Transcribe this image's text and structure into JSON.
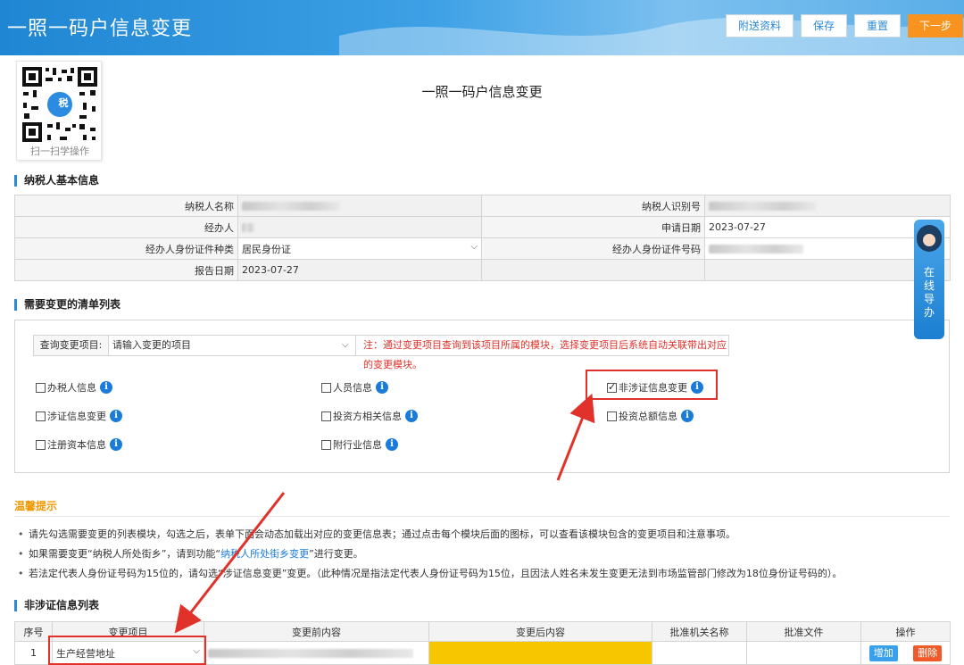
{
  "header": {
    "title": "一照一码户信息变更",
    "buttons": {
      "attach": "附送资料",
      "save": "保存",
      "reset": "重置",
      "next": "下一步"
    }
  },
  "qr": {
    "caption": "扫一扫学操作",
    "logo_text": "税"
  },
  "page_title": "一照一码户信息变更",
  "basic_info": {
    "section_title": "纳税人基本信息",
    "labels": {
      "taxpayer_name": "纳税人名称",
      "taxpayer_id": "纳税人识别号",
      "agent": "经办人",
      "apply_date": "申请日期",
      "id_type": "经办人身份证件种类",
      "id_no": "经办人身份证件号码",
      "report_date": "报告日期"
    },
    "values": {
      "apply_date": "2023-07-27",
      "id_type": "居民身份证",
      "report_date": "2023-07-27"
    }
  },
  "change_list": {
    "section_title": "需要变更的清单列表",
    "query_label": "查询变更项目:",
    "query_placeholder": "请输入变更的项目",
    "query_note": "注：通过变更项目查询到该项目所属的模块，选择变更项目后系统自动关联带出对应的变更模块。",
    "options": [
      {
        "label": "办税人信息",
        "checked": false
      },
      {
        "label": "人员信息",
        "checked": false
      },
      {
        "label": "非涉证信息变更",
        "checked": true
      },
      {
        "label": "涉证信息变更",
        "checked": false
      },
      {
        "label": "投资方相关信息",
        "checked": false
      },
      {
        "label": "投资总额信息",
        "checked": false
      },
      {
        "label": "注册资本信息",
        "checked": false
      },
      {
        "label": "附行业信息",
        "checked": false
      }
    ]
  },
  "tips": {
    "title": "温馨提示",
    "line1": "请先勾选需要变更的列表模块，勾选之后，表单下面会动态加载出对应的变更信息表；通过点击每个模块后面的图标，可以查看该模块包含的变更项目和注意事项。",
    "line2_a": "如果需要变更“纳税人所处街乡”，请到功能“",
    "line2_link": "纳税人所处街乡变更",
    "line2_b": "”进行变更。",
    "line3": "若法定代表人身份证号码为15位的，请勾选“涉证信息变更”变更。（此种情况是指法定代表人身份证号码为15位，且因法人姓名未发生变更无法到市场监管部门修改为18位身份证号码的）。"
  },
  "non_cert": {
    "section_title": "非涉证信息列表",
    "columns": [
      "序号",
      "变更项目",
      "变更前内容",
      "变更后内容",
      "批准机关名称",
      "批准文件",
      "操作"
    ],
    "row": {
      "index": "1",
      "item": "生产经营地址",
      "add": "增加",
      "del": "删除"
    }
  },
  "float_guide": {
    "text": "在线导办"
  },
  "colors": {
    "primary": "#2b8ad6",
    "orange": "#f7931e",
    "red": "#e0312a",
    "tip": "#f39800"
  }
}
